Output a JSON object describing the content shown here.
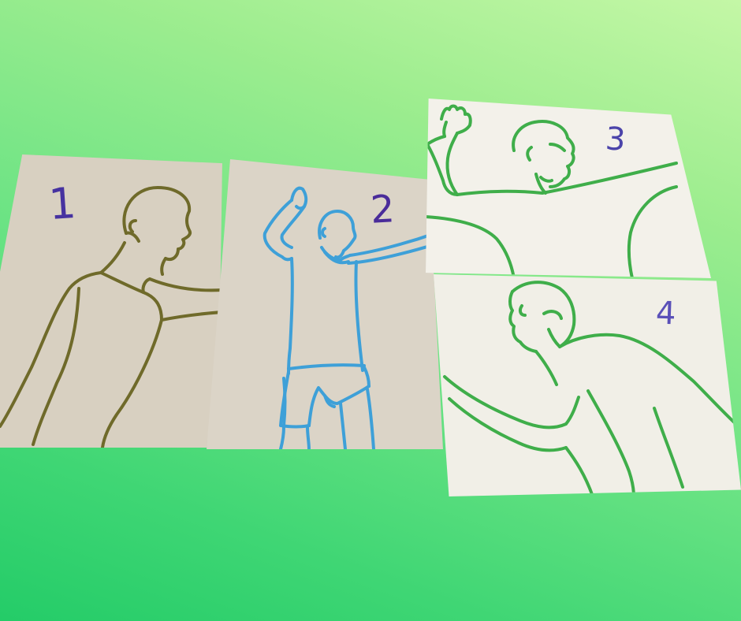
{
  "cards": [
    {
      "number": "1",
      "ink_color": "#6f6a2a",
      "number_color": "#4632a0"
    },
    {
      "number": "2",
      "ink_color": "#3ea0d8",
      "number_color": "#4a2c9a"
    },
    {
      "number": "3",
      "ink_color": "#3fae4a",
      "number_color": "#4b44aa"
    },
    {
      "number": "4",
      "ink_color": "#3fae4a",
      "number_color": "#5a50b8"
    }
  ],
  "background": {
    "top_color": "#c4f7a6",
    "bottom_color": "#24cc68"
  }
}
